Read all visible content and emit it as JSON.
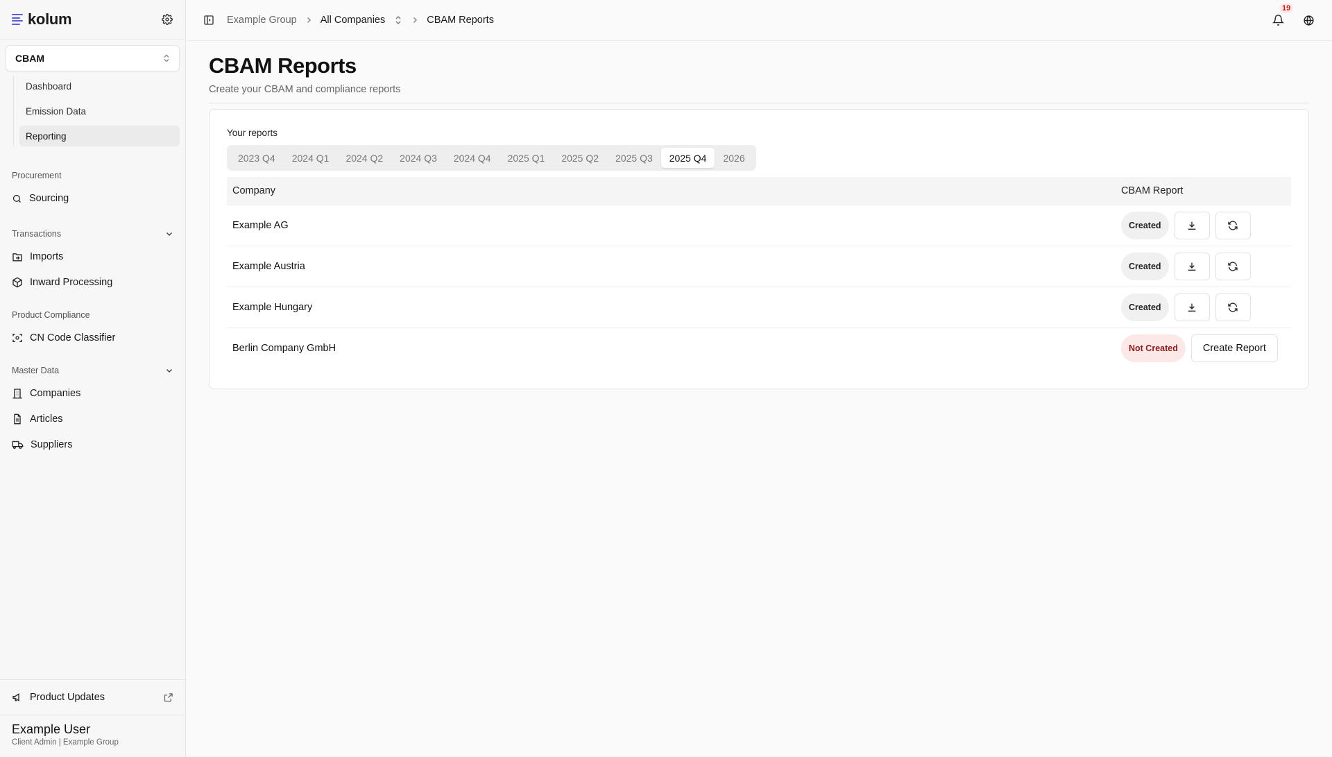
{
  "brand": {
    "name": "kolum",
    "accent": "#5b5bd6"
  },
  "sidebar": {
    "module": "CBAM",
    "subnav": [
      {
        "label": "Dashboard",
        "active": false
      },
      {
        "label": "Emission Data",
        "active": false
      },
      {
        "label": "Reporting",
        "active": true
      }
    ],
    "groups": {
      "procurement": {
        "title": "Procurement",
        "items": [
          {
            "label": "Sourcing",
            "icon": "search-icon"
          }
        ]
      },
      "transactions": {
        "title": "Transactions",
        "items": [
          {
            "label": "Imports",
            "icon": "folder-import-icon"
          },
          {
            "label": "Inward Processing",
            "icon": "package-icon"
          }
        ]
      },
      "compliance": {
        "title": "Product Compliance",
        "items": [
          {
            "label": "CN Code Classifier",
            "icon": "scan-icon"
          }
        ]
      },
      "master": {
        "title": "Master Data",
        "items": [
          {
            "label": "Companies",
            "icon": "building-icon"
          },
          {
            "label": "Articles",
            "icon": "document-icon"
          },
          {
            "label": "Suppliers",
            "icon": "truck-icon"
          }
        ]
      }
    },
    "product_updates": "Product Updates",
    "user": {
      "name": "Example User",
      "role": "Client Admin | Example Group"
    }
  },
  "header": {
    "crumbs": {
      "group": "Example Group",
      "companies": "All Companies",
      "current": "CBAM Reports"
    },
    "notifications": "19"
  },
  "page": {
    "title": "CBAM Reports",
    "subtitle": "Create your CBAM and compliance reports",
    "section_label": "Your reports",
    "tabs": [
      {
        "label": "2023 Q4",
        "active": false
      },
      {
        "label": "2024 Q1",
        "active": false
      },
      {
        "label": "2024 Q2",
        "active": false
      },
      {
        "label": "2024 Q3",
        "active": false
      },
      {
        "label": "2024 Q4",
        "active": false
      },
      {
        "label": "2025 Q1",
        "active": false
      },
      {
        "label": "2025 Q2",
        "active": false
      },
      {
        "label": "2025 Q3",
        "active": false
      },
      {
        "label": "2025 Q4",
        "active": true
      },
      {
        "label": "2026",
        "active": false
      }
    ],
    "table": {
      "columns": {
        "company": "Company",
        "report": "CBAM Report"
      },
      "rows": [
        {
          "company": "Example AG",
          "status": "Created"
        },
        {
          "company": "Example Austria",
          "status": "Created"
        },
        {
          "company": "Example Hungary",
          "status": "Created"
        },
        {
          "company": "Berlin Company GmbH",
          "status": "Not Created",
          "action": "Create Report"
        }
      ]
    }
  }
}
